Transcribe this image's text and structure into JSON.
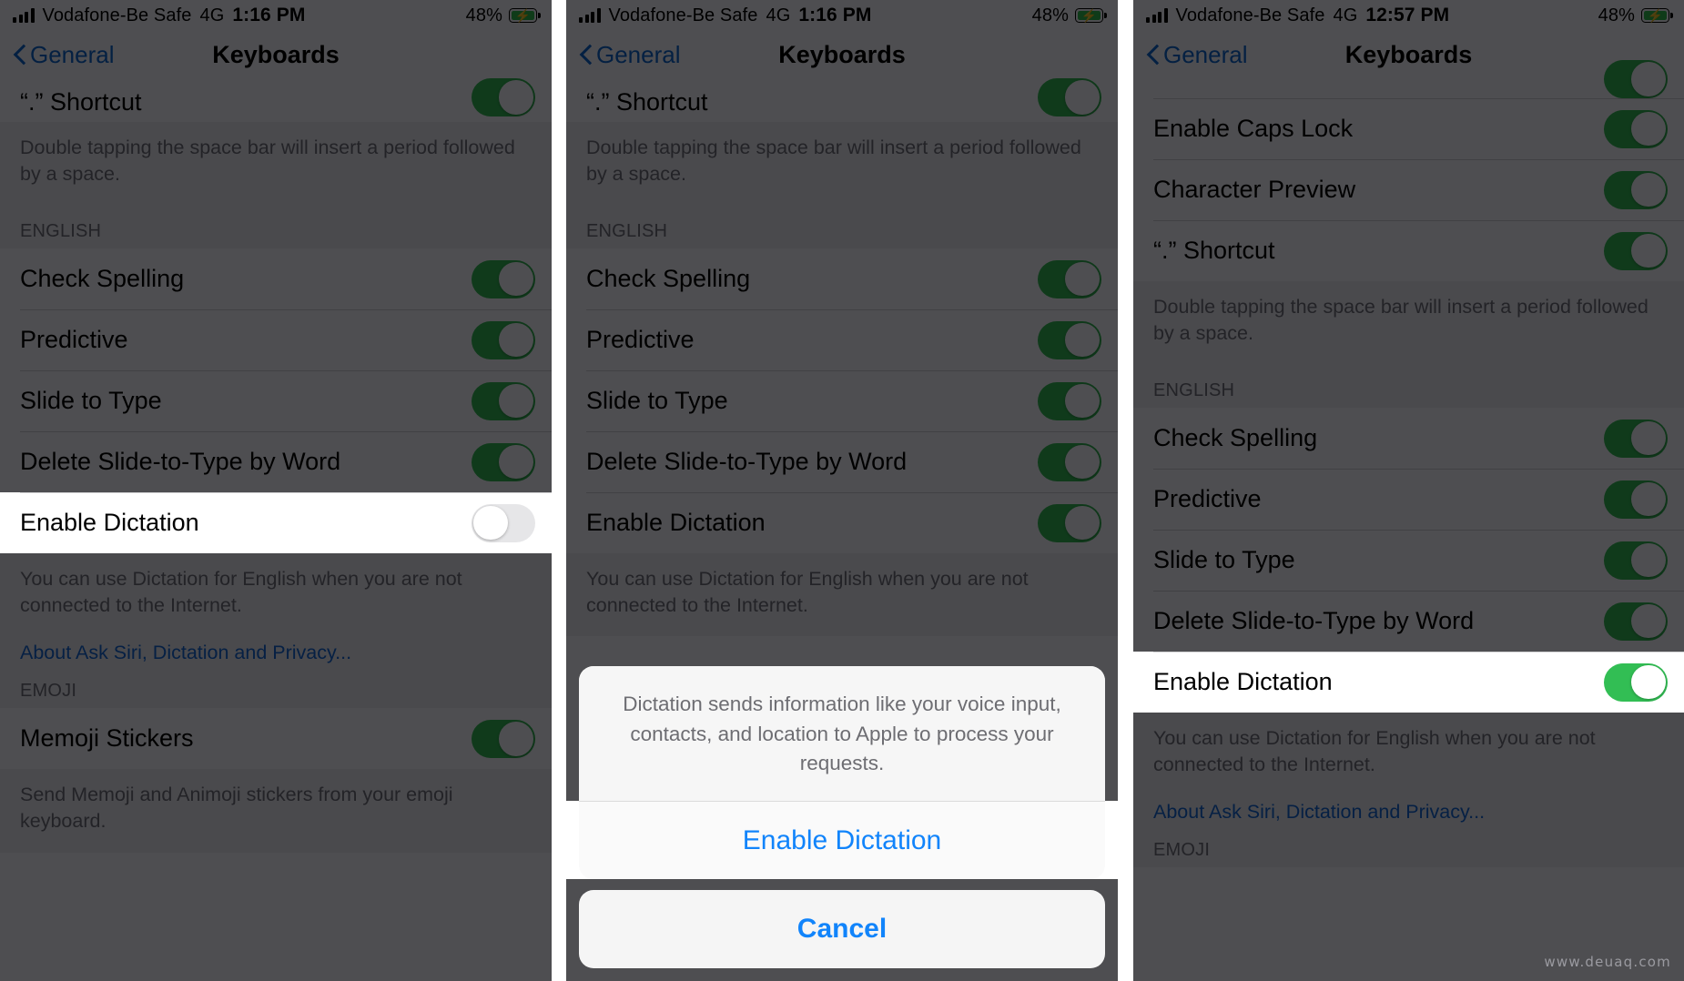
{
  "watermark": "www.deuaq.com",
  "colors": {
    "toggle_on": "#32be54",
    "toggle_off": "#e6e6e8",
    "link_blue": "#1168d4",
    "sheet_blue": "#1184fb",
    "battery_green": "#2fbf4f",
    "dim_overlay": "#4e4e51"
  },
  "panels": [
    {
      "id": "panel-1-dictation-off",
      "status_bar": {
        "signal_icon": "cellular-signal-icon",
        "carrier": "Vodafone-Be Safe",
        "network": "4G",
        "time": "1:16 PM",
        "battery_percent": "48%",
        "battery_icon": "battery-charging-icon"
      },
      "nav": {
        "back_icon": "chevron-left-icon",
        "back_label": "General",
        "title": "Keyboards"
      },
      "items": [
        {
          "type": "row",
          "label": "“.” Shortcut",
          "toggle": "on",
          "partial_top": true
        },
        {
          "type": "footnote",
          "text": "Double tapping the space bar will insert a period followed by a space."
        },
        {
          "type": "header",
          "text": "ENGLISH"
        },
        {
          "type": "row",
          "label": "Check Spelling",
          "toggle": "on"
        },
        {
          "type": "row",
          "label": "Predictive",
          "toggle": "on"
        },
        {
          "type": "row",
          "label": "Slide to Type",
          "toggle": "on"
        },
        {
          "type": "row",
          "label": "Delete Slide-to-Type by Word",
          "toggle": "on"
        },
        {
          "type": "row",
          "label": "Enable Dictation",
          "toggle": "off",
          "highlight": true
        },
        {
          "type": "footnote",
          "text": "You can use Dictation for English when you are not connected to the Internet."
        },
        {
          "type": "link",
          "text": "About Ask Siri, Dictation and Privacy..."
        },
        {
          "type": "header",
          "text": "EMOJI"
        },
        {
          "type": "row",
          "label": "Memoji Stickers",
          "toggle": "on"
        },
        {
          "type": "footnote",
          "text": "Send Memoji and Animoji stickers from your emoji keyboard."
        }
      ],
      "sheet": null
    },
    {
      "id": "panel-2-confirm-sheet",
      "status_bar": {
        "signal_icon": "cellular-signal-icon",
        "carrier": "Vodafone-Be Safe",
        "network": "4G",
        "time": "1:16 PM",
        "battery_percent": "48%",
        "battery_icon": "battery-charging-icon"
      },
      "nav": {
        "back_icon": "chevron-left-icon",
        "back_label": "General",
        "title": "Keyboards"
      },
      "items": [
        {
          "type": "row",
          "label": "“.” Shortcut",
          "toggle": "on",
          "partial_top": true
        },
        {
          "type": "footnote",
          "text": "Double tapping the space bar will insert a period followed by a space."
        },
        {
          "type": "header",
          "text": "ENGLISH"
        },
        {
          "type": "row",
          "label": "Check Spelling",
          "toggle": "on"
        },
        {
          "type": "row",
          "label": "Predictive",
          "toggle": "on"
        },
        {
          "type": "row",
          "label": "Slide to Type",
          "toggle": "on"
        },
        {
          "type": "row",
          "label": "Delete Slide-to-Type by Word",
          "toggle": "on"
        },
        {
          "type": "row",
          "label": "Enable Dictation",
          "toggle": "on"
        },
        {
          "type": "footnote",
          "text": "You can use Dictation for English when you are not connected to the Internet."
        }
      ],
      "sheet": {
        "message": "Dictation sends information like your voice input, contacts, and location to Apple to process your requests.",
        "confirm_label": "Enable Dictation",
        "cancel_label": "Cancel"
      }
    },
    {
      "id": "panel-3-dictation-on",
      "status_bar": {
        "signal_icon": "cellular-signal-icon",
        "carrier": "Vodafone-Be Safe",
        "network": "4G",
        "time": "12:57 PM",
        "battery_percent": "48%",
        "battery_icon": "battery-charging-icon"
      },
      "nav": {
        "back_icon": "chevron-left-icon",
        "back_label": "General",
        "title": "Keyboards"
      },
      "items": [
        {
          "type": "row",
          "label": "",
          "toggle": "on",
          "partial_top": true,
          "clipped": true
        },
        {
          "type": "row",
          "label": "Enable Caps Lock",
          "toggle": "on"
        },
        {
          "type": "row",
          "label": "Character Preview",
          "toggle": "on"
        },
        {
          "type": "row",
          "label": "“.” Shortcut",
          "toggle": "on"
        },
        {
          "type": "footnote",
          "text": "Double tapping the space bar will insert a period followed by a space."
        },
        {
          "type": "header",
          "text": "ENGLISH"
        },
        {
          "type": "row",
          "label": "Check Spelling",
          "toggle": "on"
        },
        {
          "type": "row",
          "label": "Predictive",
          "toggle": "on"
        },
        {
          "type": "row",
          "label": "Slide to Type",
          "toggle": "on"
        },
        {
          "type": "row",
          "label": "Delete Slide-to-Type by Word",
          "toggle": "on"
        },
        {
          "type": "row",
          "label": "Enable Dictation",
          "toggle": "on",
          "highlight": true
        },
        {
          "type": "footnote",
          "text": "You can use Dictation for English when you are not connected to the Internet."
        },
        {
          "type": "link",
          "text": "About Ask Siri, Dictation and Privacy..."
        },
        {
          "type": "header",
          "text": "EMOJI"
        }
      ],
      "sheet": null
    }
  ]
}
